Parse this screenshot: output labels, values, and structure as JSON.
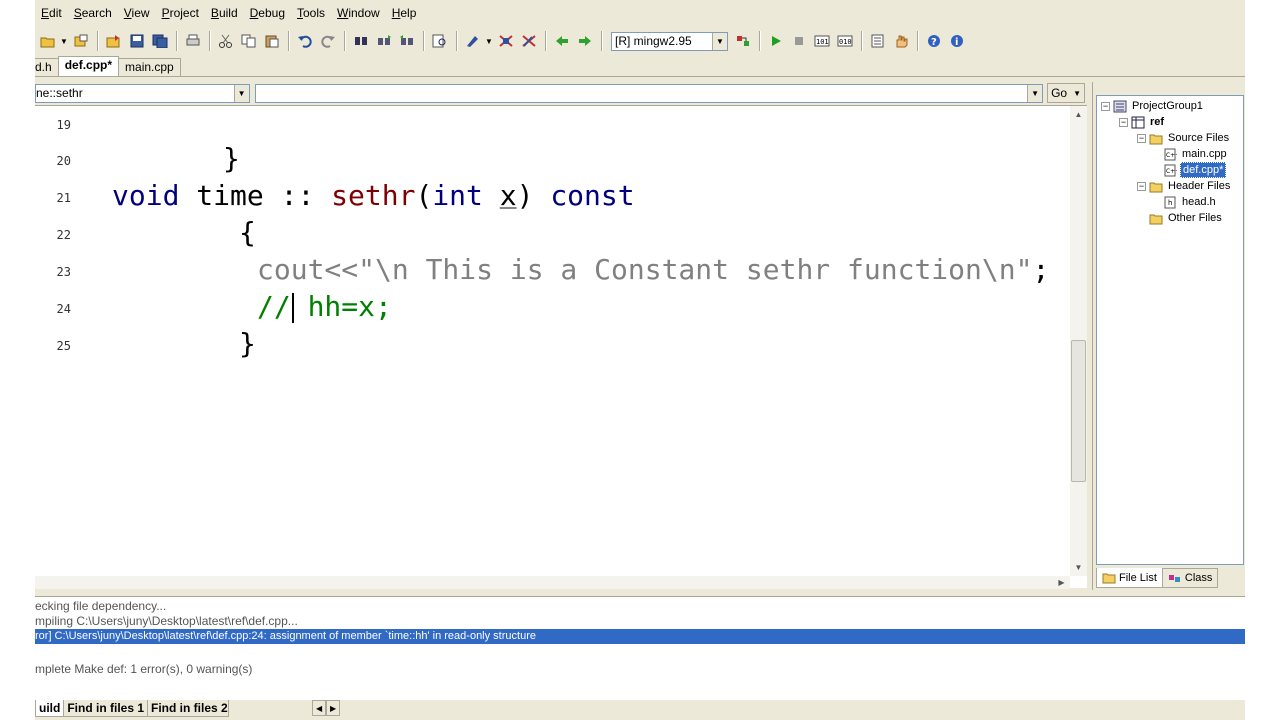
{
  "menu": [
    "Edit",
    "Search",
    "View",
    "Project",
    "Build",
    "Debug",
    "Tools",
    "Window",
    "Help"
  ],
  "toolbar": {
    "compiler_value": "[R] mingw2.95",
    "icons": [
      "open-folder-icon",
      "new-project-icon",
      "open-project-icon",
      "save-icon",
      "save-all-icon",
      "print-icon",
      "cut-icon",
      "copy-icon",
      "paste-icon",
      "undo-icon",
      "redo-icon",
      "find-icon",
      "find-next-icon",
      "find-prev-icon",
      "find-in-files-icon",
      "breakpoint-icon",
      "debug-toggle-icon",
      "clear-breakpoints-icon",
      "back-arrow-icon",
      "forward-arrow-icon",
      "rebuild-icon",
      "run-icon",
      "stop-icon",
      "build-icon",
      "build-all-icon",
      "options-icon",
      "hand-icon",
      "help-icon",
      "info-icon"
    ]
  },
  "tabs": [
    {
      "label": "d.h",
      "active": false
    },
    {
      "label": "def.cpp*",
      "active": true
    },
    {
      "label": "main.cpp",
      "active": false
    }
  ],
  "nav": {
    "scope_value": "ne::sethr",
    "symbol_value": "",
    "go_label": "Go"
  },
  "code_lines": [
    {
      "num": "19",
      "tokens": []
    },
    {
      "num": "20",
      "tokens": [
        {
          "t": "op",
          "v": "}"
        }
      ]
    },
    {
      "num": "21",
      "tokens": [
        {
          "t": "kw",
          "v": "void"
        },
        {
          "t": "op",
          "v": " time :: "
        },
        {
          "t": "fn",
          "v": "sethr"
        },
        {
          "t": "op",
          "v": "("
        },
        {
          "t": "kw",
          "v": "int"
        },
        {
          "t": "op",
          "v": " "
        },
        {
          "t": "pm",
          "v": "x"
        },
        {
          "t": "op",
          "v": ") "
        },
        {
          "t": "kw",
          "v": "const"
        }
      ]
    },
    {
      "num": "22",
      "tokens": [
        {
          "t": "op",
          "v": "{"
        }
      ]
    },
    {
      "num": "23",
      "tokens": [
        {
          "t": "str",
          "v": "cout<<\"\\n This is a Constant sethr function\\n\""
        },
        {
          "t": "op",
          "v": ";"
        }
      ]
    },
    {
      "num": "24",
      "tokens": [
        {
          "t": "cm",
          "v": "// hh=x;"
        }
      ]
    },
    {
      "num": "25",
      "tokens": [
        {
          "t": "op",
          "v": "}"
        }
      ]
    }
  ],
  "tree": [
    {
      "label": "ProjectGroup1",
      "icon": "project-group-icon",
      "expander": "−",
      "selected": false,
      "bold": false
    },
    {
      "label": "ref",
      "icon": "project-icon",
      "expander": "−",
      "selected": false,
      "bold": true
    },
    {
      "label": "Source Files",
      "icon": "folder-icon",
      "expander": "−",
      "selected": false,
      "bold": false
    },
    {
      "label": "main.cpp",
      "icon": "cpp-file-icon",
      "expander": "",
      "selected": false,
      "bold": false
    },
    {
      "label": "def.cpp*",
      "icon": "cpp-file-icon",
      "expander": "",
      "selected": true,
      "bold": false
    },
    {
      "label": "Header Files",
      "icon": "folder-icon",
      "expander": "−",
      "selected": false,
      "bold": false
    },
    {
      "label": "head.h",
      "icon": "header-file-icon",
      "expander": "",
      "selected": false,
      "bold": false
    },
    {
      "label": "Other Files",
      "icon": "folder-icon",
      "expander": "",
      "selected": false,
      "bold": false
    }
  ],
  "panel_tabs": [
    {
      "label": "File List",
      "icon": "folder-icon",
      "active": true
    },
    {
      "label": "Class",
      "icon": "class-icon",
      "active": false
    }
  ],
  "output": [
    {
      "text": "ecking file dependency...",
      "error": false
    },
    {
      "text": "mpiling C:\\Users\\juny\\Desktop\\latest\\ref\\def.cpp...",
      "error": false
    },
    {
      "text": "ror] C:\\Users\\juny\\Desktop\\latest\\ref\\def.cpp:24: assignment of member `time::hh' in read-only structure",
      "error": true
    },
    {
      "text": "",
      "error": false
    },
    {
      "text": "mplete Make def: 1 error(s), 0 warning(s)",
      "error": false
    }
  ],
  "bottom_tabs": [
    {
      "label": "uild",
      "active": true
    },
    {
      "label": "Find in files 1",
      "active": false
    },
    {
      "label": "Find in files 2",
      "active": false
    }
  ],
  "colors": {
    "keyword": "#00007f",
    "function": "#7f0000",
    "string": "#808080",
    "comment": "#008000",
    "selection": "#316ac5"
  }
}
